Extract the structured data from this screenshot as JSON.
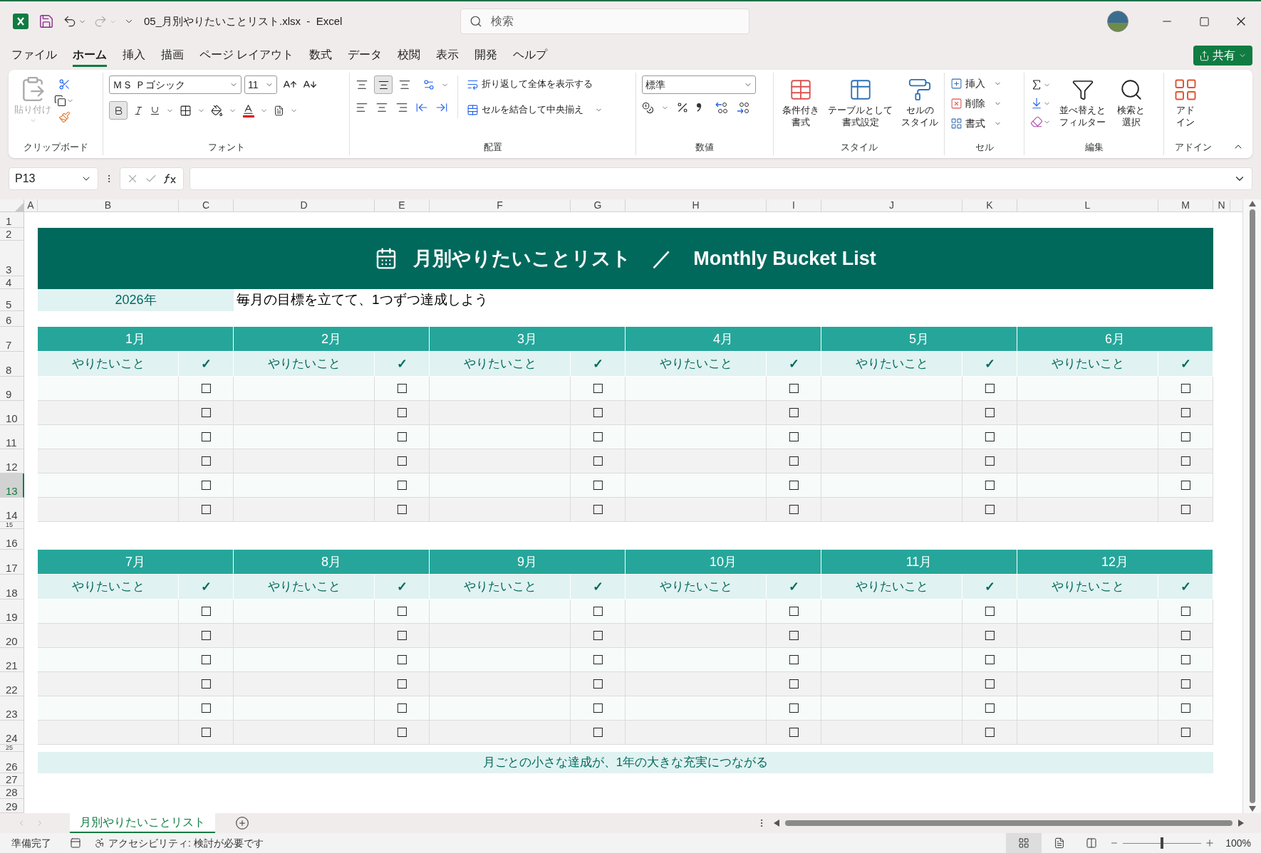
{
  "title_bar": {
    "file_name": "05_月別やりたいことリスト.xlsx  -  Excel",
    "search": {
      "placeholder": "検索"
    }
  },
  "menu_tabs": [
    {
      "label": "ファイル",
      "selected": false
    },
    {
      "label": "ホーム",
      "selected": true
    },
    {
      "label": "挿入",
      "selected": false
    },
    {
      "label": "描画",
      "selected": false
    },
    {
      "label": "ページ レイアウト",
      "selected": false
    },
    {
      "label": "数式",
      "selected": false
    },
    {
      "label": "データ",
      "selected": false
    },
    {
      "label": "校閲",
      "selected": false
    },
    {
      "label": "表示",
      "selected": false
    },
    {
      "label": "開発",
      "selected": false
    },
    {
      "label": "ヘルプ",
      "selected": false
    }
  ],
  "share_button": "共有",
  "ribbon": {
    "clipboard": {
      "paste": "貼り付け",
      "paste_disabled": true,
      "label": "クリップボード"
    },
    "font": {
      "font_name": "ＭＳ Ｐゴシック",
      "font_size": "11",
      "bold_on": true,
      "label": "フォント"
    },
    "alignment": {
      "middle_align_on": true,
      "wrap_text": "折り返して全体を表示する",
      "merge_center": "セルを結合して中央揃え",
      "label": "配置"
    },
    "number": {
      "format": "標準",
      "label": "数値"
    },
    "styles": {
      "buttons": [
        [
          "条件付き",
          "書式"
        ],
        [
          "テーブルとして",
          "書式設定"
        ],
        [
          "セルの",
          "スタイル"
        ]
      ],
      "label": "スタイル"
    },
    "cells": {
      "buttons": [
        "挿入",
        "削除",
        "書式"
      ],
      "label": "セル"
    },
    "editing": {
      "buttons": [
        [
          "並べ替えと",
          "フィルター"
        ],
        [
          "検索と",
          "選択"
        ]
      ],
      "label": "編集"
    },
    "addins": {
      "button": [
        "アド",
        "イン"
      ],
      "label": "アドイン"
    }
  },
  "formula_bar": {
    "name_box": "P13"
  },
  "column_headers": [
    "A",
    "B",
    "C",
    "D",
    "E",
    "F",
    "G",
    "H",
    "I",
    "J",
    "K",
    "L",
    "M",
    "N"
  ],
  "row_headers": [
    {
      "label": "1",
      "selected": false
    },
    {
      "label": "2",
      "selected": false
    },
    {
      "label": "3",
      "selected": false
    },
    {
      "label": "4",
      "selected": false
    },
    {
      "label": "5",
      "selected": false
    },
    {
      "label": "6",
      "selected": false
    },
    {
      "label": "7",
      "selected": false
    },
    {
      "label": "8",
      "selected": false
    },
    {
      "label": "9",
      "selected": false
    },
    {
      "label": "10",
      "selected": false
    },
    {
      "label": "11",
      "selected": false
    },
    {
      "label": "12",
      "selected": false
    },
    {
      "label": "13",
      "selected": true
    },
    {
      "label": "14",
      "selected": false
    },
    {
      "label": "15",
      "selected": false
    },
    {
      "label": "16",
      "selected": false
    },
    {
      "label": "17",
      "selected": false
    },
    {
      "label": "18",
      "selected": false
    },
    {
      "label": "19",
      "selected": false
    },
    {
      "label": "20",
      "selected": false
    },
    {
      "label": "21",
      "selected": false
    },
    {
      "label": "22",
      "selected": false
    },
    {
      "label": "23",
      "selected": false
    },
    {
      "label": "24",
      "selected": false
    },
    {
      "label": "25",
      "selected": false
    },
    {
      "label": "26",
      "selected": false
    },
    {
      "label": "27",
      "selected": false
    },
    {
      "label": "28",
      "selected": false
    },
    {
      "label": "29",
      "selected": false
    }
  ],
  "sheet": {
    "title_jp": "月別やりたいことリスト",
    "title_sep": "／",
    "title_en": "Monthly Bucket List",
    "year": "2026年",
    "subtitle": "毎月の目標を立てて、1つずつ達成しよう",
    "months": [
      {
        "name": "1月",
        "task_header": "やりたいこと",
        "check_header": "✓",
        "boxes": [
          "☐",
          "☐",
          "☐",
          "☐",
          "☐",
          "☐"
        ]
      },
      {
        "name": "2月",
        "task_header": "やりたいこと",
        "check_header": "✓",
        "boxes": [
          "☐",
          "☐",
          "☐",
          "☐",
          "☐",
          "☐"
        ]
      },
      {
        "name": "3月",
        "task_header": "やりたいこと",
        "check_header": "✓",
        "boxes": [
          "☐",
          "☐",
          "☐",
          "☐",
          "☐",
          "☐"
        ]
      },
      {
        "name": "4月",
        "task_header": "やりたいこと",
        "check_header": "✓",
        "boxes": [
          "☐",
          "☐",
          "☐",
          "☐",
          "☐",
          "☐"
        ]
      },
      {
        "name": "5月",
        "task_header": "やりたいこと",
        "check_header": "✓",
        "boxes": [
          "☐",
          "☐",
          "☐",
          "☐",
          "☐",
          "☐"
        ]
      },
      {
        "name": "6月",
        "task_header": "やりたいこと",
        "check_header": "✓",
        "boxes": [
          "☐",
          "☐",
          "☐",
          "☐",
          "☐",
          "☐"
        ]
      },
      {
        "name": "7月",
        "task_header": "やりたいこと",
        "check_header": "✓",
        "boxes": [
          "☐",
          "☐",
          "☐",
          "☐",
          "☐",
          "☐"
        ]
      },
      {
        "name": "8月",
        "task_header": "やりたいこと",
        "check_header": "✓",
        "boxes": [
          "☐",
          "☐",
          "☐",
          "☐",
          "☐",
          "☐"
        ]
      },
      {
        "name": "9月",
        "task_header": "やりたいこと",
        "check_header": "✓",
        "boxes": [
          "☐",
          "☐",
          "☐",
          "☐",
          "☐",
          "☐"
        ]
      },
      {
        "name": "10月",
        "task_header": "やりたいこと",
        "check_header": "✓",
        "boxes": [
          "☐",
          "☐",
          "☐",
          "☐",
          "☐",
          "☐"
        ]
      },
      {
        "name": "11月",
        "task_header": "やりたいこと",
        "check_header": "✓",
        "boxes": [
          "☐",
          "☐",
          "☐",
          "☐",
          "☐",
          "☐"
        ]
      },
      {
        "name": "12月",
        "task_header": "やりたいこと",
        "check_header": "✓",
        "boxes": [
          "☐",
          "☐",
          "☐",
          "☐",
          "☐",
          "☐"
        ]
      }
    ],
    "footer": "月ごとの小さな達成が、1年の大きな充実につながる"
  },
  "sheet_tabs": [
    {
      "label": "月別やりたいことリスト",
      "selected": true
    }
  ],
  "status_bar": {
    "ready": "準備完了",
    "accessibility": "アクセシビリティ: 検討が必要です",
    "zoom": "100%",
    "zoom_slider": {
      "level": 0.5
    }
  }
}
